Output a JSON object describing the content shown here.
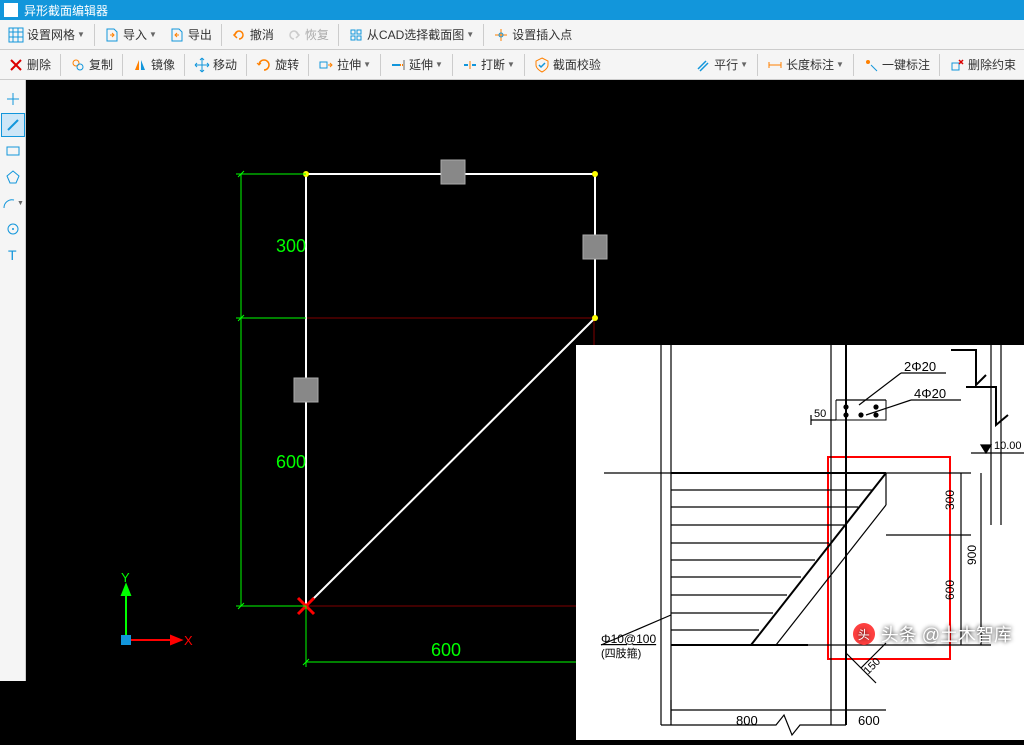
{
  "title": "异形截面编辑器",
  "toolbar1": {
    "grid": "设置网格",
    "import": "导入",
    "export": "导出",
    "undo": "撤消",
    "redo": "恢复",
    "from_cad": "从CAD选择截面图",
    "insert_point": "设置插入点"
  },
  "toolbar2": {
    "delete": "删除",
    "copy": "复制",
    "mirror": "镜像",
    "move": "移动",
    "rotate": "旋转",
    "stretch": "拉伸",
    "extend": "延伸",
    "break": "打断",
    "validate": "截面校验",
    "parallel": "平行",
    "length_dim": "长度标注",
    "one_click_dim": "一键标注",
    "delete_constraint": "删除约束"
  },
  "axes": {
    "x": "X",
    "y": "Y"
  },
  "dimensions": {
    "top_h": "300",
    "bot_h": "600",
    "width": "600"
  },
  "reference": {
    "rebar1": "2Φ20",
    "rebar2": "4Φ20",
    "stirrup": "Φ10@100",
    "stirrup_note": "(四肢箍)",
    "dim50": "50",
    "dim300": "300",
    "dim600": "600",
    "dim900": "900",
    "dim800": "800",
    "dim150": "150",
    "elev": "10.00"
  },
  "watermark": "头条 @土木智库"
}
